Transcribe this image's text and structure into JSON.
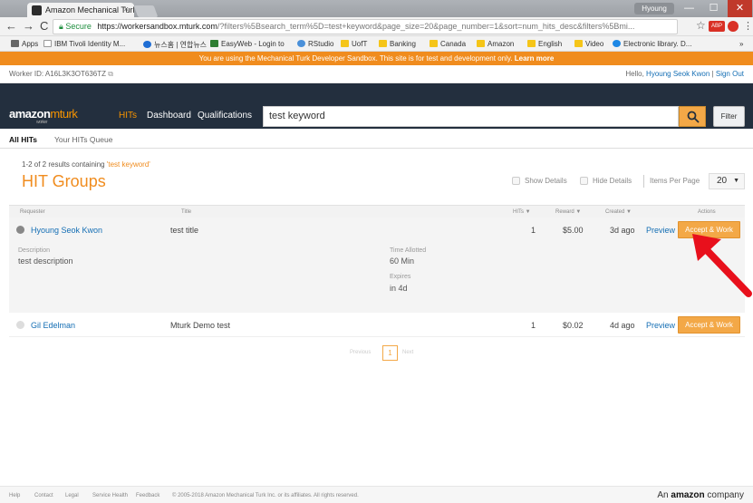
{
  "browser": {
    "tab_title": "Amazon Mechanical Turk",
    "tab_close": "×",
    "profile": "Hyoung Seok",
    "win_min": "—",
    "win_max": "☐",
    "win_close": "✕",
    "nav_glyphs": "←→C⌂",
    "secure_label": "Secure",
    "url_domain": "https://workersandbox.mturk.com",
    "url_rest": "/?filters%5Bsearch_term%5D=test+keyword&page_size=20&page_number=1&sort=num_hits_desc&filters%5Bmi...",
    "star": "☆",
    "ext_label": "ABP",
    "menu": "⋮",
    "bookmarks": [
      "Apps",
      "IBM Tivoli Identity M...",
      "뉴스홈 | 연합뉴스",
      "EasyWeb - Login to",
      "RStudio",
      "UofT",
      "Banking",
      "Canada",
      "Amazon",
      "English",
      "Video",
      "Electronic library. D..."
    ],
    "bookmarks_more": "»"
  },
  "sandbox_banner": {
    "text": "You are using the Mechanical Turk Developer Sandbox. This site is for test and development only.",
    "link": "Learn more"
  },
  "worker_bar": {
    "worker_id": "Worker ID: A16L3K3OT636TZ",
    "hello": "Hello,",
    "user": "Hyoung Seok Kwon",
    "divider": "|",
    "signout": "Sign Out"
  },
  "nav": {
    "logo_main": "amazon",
    "logo_mt": "mturk",
    "logo_sub": "worker",
    "hits": "HITs",
    "dashboard": "Dashboard",
    "qualifications": "Qualifications",
    "search_value": "test keyword",
    "filter": "Filter"
  },
  "subtabs": {
    "all": "All HITs",
    "queue": "Your HITs Queue"
  },
  "results": {
    "prefix": "1-2 of 2 results containing",
    "keyword": "'test keyword'"
  },
  "page_title": "HIT Groups",
  "controls": {
    "show_details": "Show Details",
    "hide_details": "Hide Details",
    "items_per_page": "Items Per Page",
    "ipp_value": "20",
    "ipp_arrow": "▼"
  },
  "table": {
    "headers": {
      "requester": "Requester",
      "title": "Title",
      "hits": "HITs ▼",
      "reward": "Reward ▼",
      "created": "Created ▼",
      "actions": "Actions"
    },
    "rows": [
      {
        "requester": "Hyoung Seok Kwon",
        "title": "test title",
        "hits": "1",
        "reward": "$5.00",
        "created": "3d ago",
        "preview": "Preview",
        "accept": "Accept & Work"
      },
      {
        "requester": "Gil Edelman",
        "title": "Mturk Demo test",
        "hits": "1",
        "reward": "$0.02",
        "created": "4d ago",
        "preview": "Preview",
        "accept": "Accept & Work"
      }
    ],
    "detail": {
      "description_label": "Description",
      "description": "test description",
      "time_label": "Time Allotted",
      "time": "60 Min",
      "expires_label": "Expires",
      "expires": "in 4d"
    }
  },
  "pager": {
    "prev": "Previous",
    "current": "1",
    "next": "Next"
  },
  "footer": {
    "links": [
      "Help",
      "Contact",
      "Legal",
      "Service Health",
      "Feedback"
    ],
    "copyright": "© 2005-2018 Amazon Mechanical Turk Inc. or its affiliates. All rights reserved.",
    "company_pre": "An",
    "company_brand": "amazon",
    "company_post": "company"
  },
  "colors": {
    "orange": "#f08c1e",
    "button": "#f3a847",
    "navbar": "#232f3e",
    "link": "#146eb4",
    "arrow": "#e8101c"
  },
  "icons": [
    "search-icon",
    "back-icon",
    "forward-icon",
    "reload-icon",
    "home-icon",
    "lock-icon",
    "star-icon",
    "copy-icon",
    "collapse-circle-icon",
    "expand-circle-icon",
    "red-arrow-annotation"
  ]
}
